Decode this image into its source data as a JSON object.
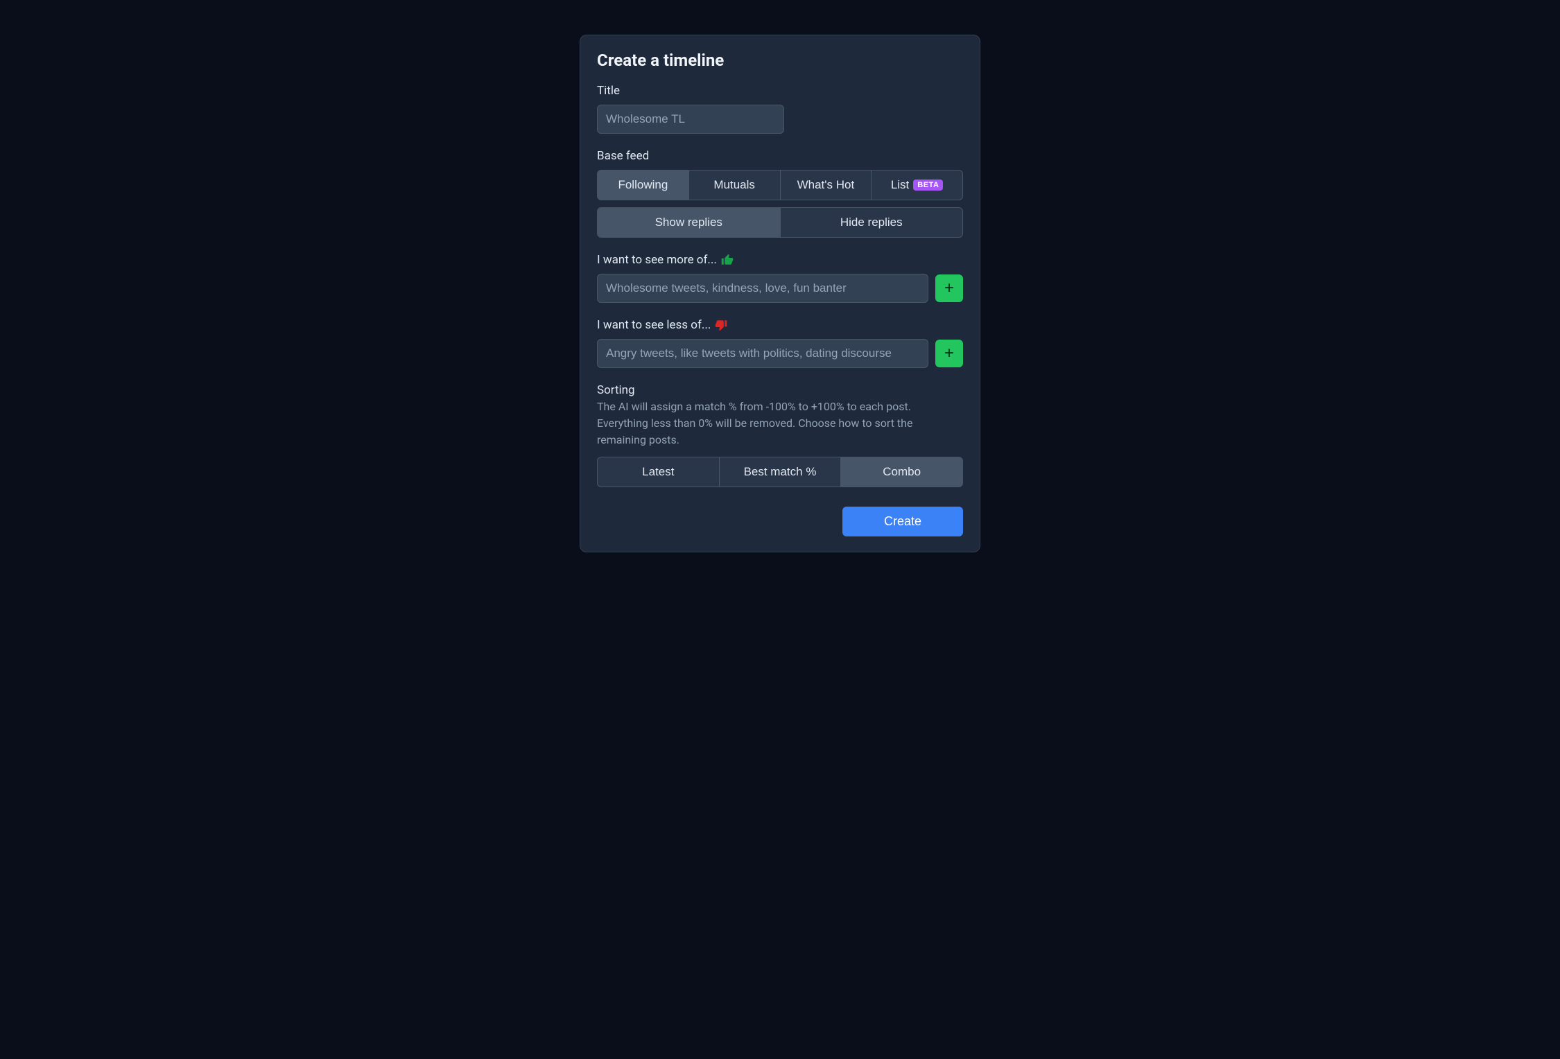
{
  "modal": {
    "title": "Create a timeline",
    "titleField": {
      "label": "Title",
      "placeholder": "Wholesome TL",
      "value": ""
    },
    "baseFeed": {
      "label": "Base feed",
      "options": [
        "Following",
        "Mutuals",
        "What's Hot",
        "List"
      ],
      "betaLabel": "BETA",
      "selectedIndex": 0,
      "replyOptions": [
        "Show replies",
        "Hide replies"
      ],
      "replySelected": 0
    },
    "moreOf": {
      "label": "I want to see more of...",
      "placeholder": "Wholesome tweets, kindness, love, fun banter",
      "value": ""
    },
    "lessOf": {
      "label": "I want to see less of...",
      "placeholder": "Angry tweets, like tweets with politics, dating discourse",
      "value": ""
    },
    "sorting": {
      "label": "Sorting",
      "description": "The AI will assign a match % from -100% to +100% to each post. Everything less than 0% will be removed. Choose how to sort the remaining posts.",
      "options": [
        "Latest",
        "Best match %",
        "Combo"
      ],
      "selectedIndex": 2
    },
    "createButton": "Create",
    "plusSymbol": "+"
  }
}
